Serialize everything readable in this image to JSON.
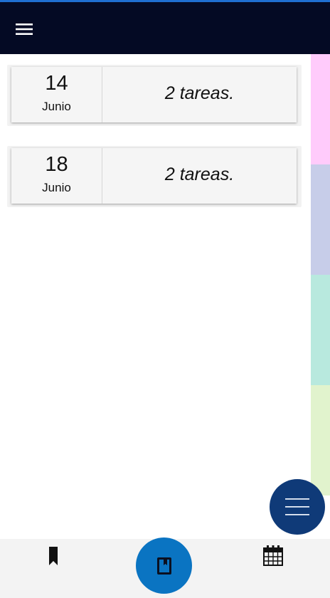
{
  "app_bar": {
    "menu_icon": "hamburger-menu-icon",
    "background_color": "#040a24",
    "accent_color": "#1f6fd1"
  },
  "side_strip": {
    "colors": [
      "#ffcbfb",
      "#c7cde9",
      "#b8e9de",
      "#e1f3cd"
    ]
  },
  "day_cards": [
    {
      "day": "14",
      "month": "Junio",
      "tasks": "2 tareas."
    },
    {
      "day": "18",
      "month": "Junio",
      "tasks": "2 tareas."
    }
  ],
  "fab": {
    "icon": "menu-lines-icon",
    "color": "#0f3a78"
  },
  "bottom_nav": {
    "left_icon": "bookmark-icon",
    "center_icon": "notebook-icon",
    "center_color": "#0a74c2",
    "right_icon": "calendar-icon"
  }
}
